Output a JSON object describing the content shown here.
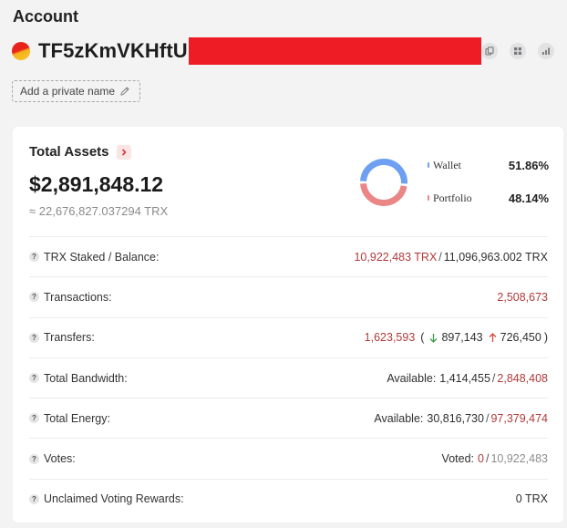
{
  "page": {
    "title": "Account"
  },
  "address": {
    "visible_prefix": "TF5zKmVKHftU"
  },
  "private_name": {
    "label": "Add a private name"
  },
  "icons": {
    "copy": "copy-icon",
    "qrcode": "qrcode-icon",
    "chart": "chart-icon",
    "edit": "pencil-icon",
    "info": "question-icon"
  },
  "total_assets": {
    "label": "Total Assets",
    "usd": "$2,891,848.12",
    "trx": "≈ 22,676,827.037294 TRX",
    "breakdown": [
      {
        "name": "Wallet",
        "percent": "51.86%",
        "color": "#6e9ff0"
      },
      {
        "name": "Portfolio",
        "percent": "48.14%",
        "color": "#ea8686"
      }
    ]
  },
  "stats": {
    "staked": {
      "label": "TRX Staked / Balance:",
      "staked": "10,922,483 TRX",
      "separator": "/",
      "balance": "11,096,963.002 TRX"
    },
    "transactions": {
      "label": "Transactions:",
      "value": "2,508,673"
    },
    "transfers": {
      "label": "Transfers:",
      "total": "1,623,593",
      "open": "(",
      "in": "897,143",
      "out": "726,450",
      "close": ")"
    },
    "bandwidth": {
      "label": "Total Bandwidth:",
      "prefix": "Available:",
      "available": "1,414,455",
      "separator": "/",
      "total": "2,848,408"
    },
    "energy": {
      "label": "Total Energy:",
      "prefix": "Available:",
      "available": "30,816,730",
      "separator": "/",
      "total": "97,379,474"
    },
    "votes": {
      "label": "Votes:",
      "prefix": "Voted:",
      "voted": "0",
      "separator": "/",
      "total": "10,922,483"
    },
    "rewards": {
      "label": "Unclaimed Voting Rewards:",
      "value": "0 TRX"
    }
  },
  "qmark_glyph": "?"
}
